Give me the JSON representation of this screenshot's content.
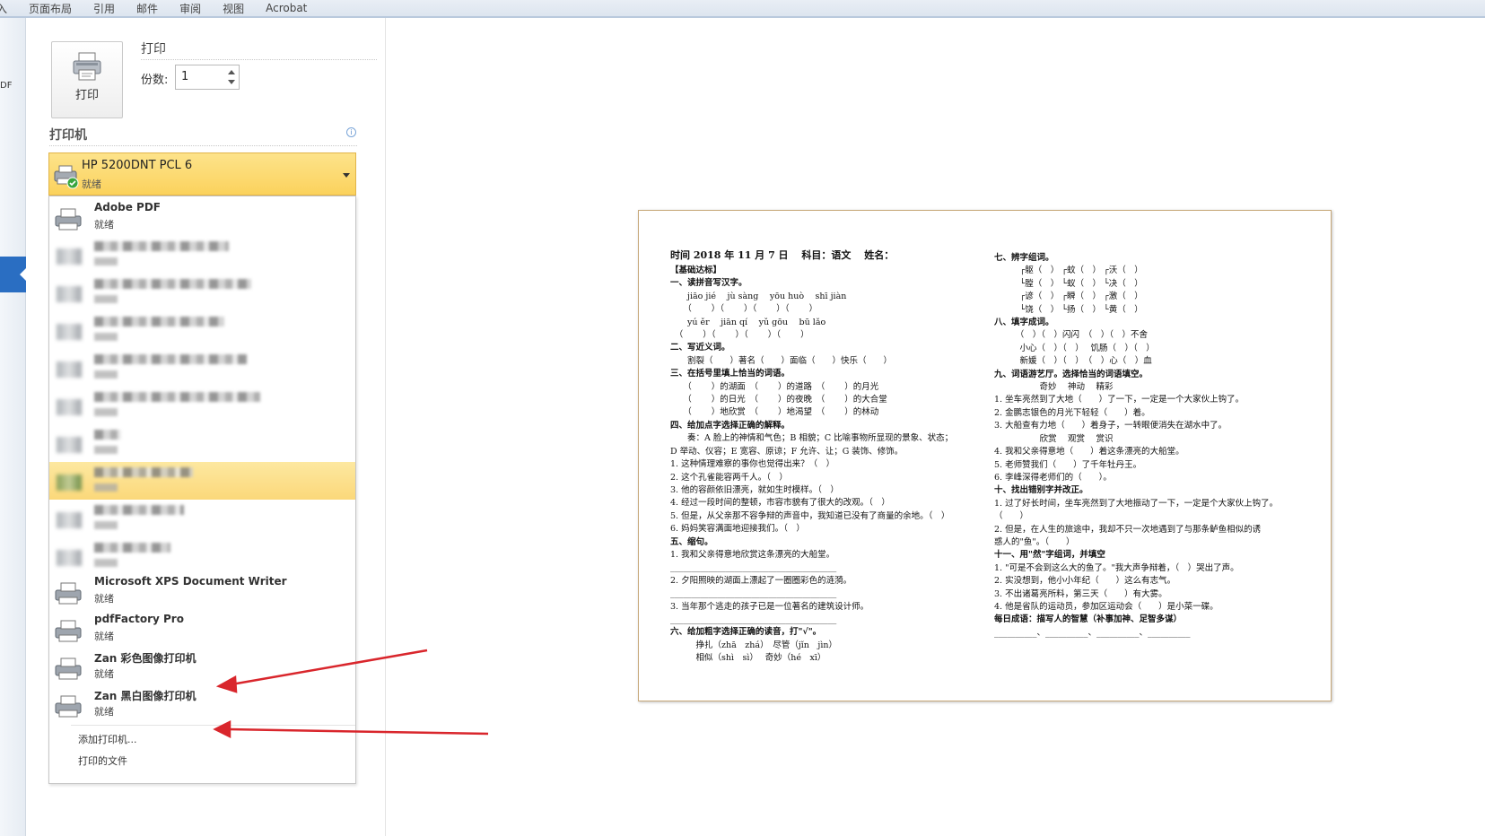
{
  "ribbon": {
    "tabs": [
      "入",
      "页面布局",
      "引用",
      "邮件",
      "审阅",
      "视图",
      "Acrobat"
    ]
  },
  "backstage": {
    "fragment": "DF"
  },
  "print_panel": {
    "button_label": "打印",
    "title": "打印",
    "copies_label": "份数:",
    "copies_value": "1"
  },
  "printer_section": {
    "heading": "打印机",
    "selected": {
      "name": "HP 5200DNT PCL 6",
      "status": "就绪"
    },
    "list": [
      {
        "name": "Adobe PDF",
        "status": "就绪"
      },
      {
        "name": "Microsoft XPS Document Writer",
        "status": "就绪"
      },
      {
        "name": "pdfFactory Pro",
        "status": "就绪"
      },
      {
        "name": "Zan 彩色图像打印机",
        "status": "就绪"
      },
      {
        "name": "Zan 黑白图像打印机",
        "status": "就绪"
      }
    ],
    "add_printer": "添加打印机...",
    "print_to_file": "打印的文件"
  },
  "colors": {
    "selection": "#fbd25c",
    "arrow": "#d9262c",
    "accent": "#2a6ec2"
  },
  "preview": {
    "left": [
      "时间 2018 年 11 月 7 日　 科目：语文　 姓名：",
      "【基础达标】",
      "一、读拼音写汉字。",
      "　　jiāo jié　 jù sàng　 yōu huò　 shī jiàn",
      "　　（　　 ）（　　 ）（　　 ）（　　 ）",
      "　　yú ěr　 jiān qí　 yǔ gōu　 bū lǎo",
      "　（　　 ）（　　 ）（　　 ）（　　 ）",
      "二、写近义词。",
      "　　割裂（　　）著名（　　）面临（　　）快乐（　　）",
      "三、在括号里填上恰当的词语。",
      "　　（　　 ）的湖面　（　　 ）的道路　（　　 ）的月光",
      "　　（　　 ）的日光　（　　 ）的夜晚　（　　 ）的大合堂",
      "　　（　　 ）地欣赏　（　　 ）地渴望　（　　 ）的林动",
      "四、给加点字选择正确的解释。",
      "　　奏：A 脸上的神情和气色；B 相貌；C 比喻事物所显现的景象、状态；",
      "D 举动、仪容；E 宽容、原谅；F 允许、让；G 装饰、修饰。",
      "1. 这种情理难察的事你也觉得出来？（　）",
      "2. 这个孔雀能容两千人。（　）",
      "3. 他的容颜依旧漂亮，就如生时模样。（　）",
      "4. 经过一段时间的整顿，市容市貌有了很大的改观。（　）",
      "5. 但是，从父亲那不容争辩的声音中，我知道已没有了商量的余地。（　）",
      "6. 妈妈笑容满面地迎接我们。（　）",
      "五、缩句。",
      "1. 我和父亲得意地欣赏这条漂亮的大船堂。",
      "_______________________________________",
      "2. 夕阳照映的湖面上漂起了一圈圈彩色的涟漪。",
      "_______________________________________",
      "3. 当年那个逃走的孩子已是一位著名的建筑设计师。",
      "_______________________________________",
      "六、给加粗字选择正确的读音，打\"√\"。",
      "　　　挣扎（zhā　zhá）　尽管（jǐn　jìn）",
      "　　　相似（shì　sì）　 奇妙（hé　xī）"
    ],
    "right": [
      "七、辨字组词。",
      "　　　┌躯（　） ┌蚊（　） ┌沃（　）",
      "　　　└膛（　） └蚁（　） └决（　）",
      "　　　┌谚（　） ┌瞬（　） ┌激（　）",
      "　　　└饶（　） └扬（　） └黄（　）",
      "八、填字成词。",
      "　　　（　）（　）闪闪　（　）（　）不舍",
      "　　　小心（　）（　）　 饥肠（　）（　）",
      "　　　新媛（　）（　）　（　）心（　）血",
      "九、词语游艺厅。选择恰当的词语填空。",
      "　　　　　 奇妙　 神动　 精彩",
      "1. 坐车亮然到了大地（　　）了一下，一定是一个大家伙上钩了。",
      "2. 金鹏志银色的月光下轻轻（　　）着。",
      "3. 大船查有力地（　　）着身子，一转眼便消失在湖水中了。",
      "　　　　　 欣赏　 观赏　 赏识",
      "4. 我和父亲得意地（　　）着这条漂亮的大船堂。",
      "5. 老师赞我们（　　）了千年牡丹王。",
      "6. 李峰深得老师们的（　　）。",
      "十、找出错别字并改正。",
      "1. 过了好长时间，坐车亮然到了大地振动了一下，一定是个大家伙上钩了。",
      "（　　）",
      "2. 但是，在人生的旅途中，我却不只一次地遇到了与那条鲈鱼相似的诱",
      "惑人的\"鱼\"。（　　）",
      "十一、用\"然\"字组词，并填空",
      "1. \"可是不会到这么大的鱼了。\"我大声争辩着，（　）哭出了声。",
      "2. 实没想到，他小小年纪（　　）这么有志气。",
      "3. 不出诸葛亮所料，第三天（　　）有大雾。",
      "4. 他是省队的运动员，参加区运动会（　　）是小菜一碟。",
      "每日成语：描写人的智慧（补事加神、足智多谋）",
      "__________、__________、__________、__________"
    ]
  }
}
